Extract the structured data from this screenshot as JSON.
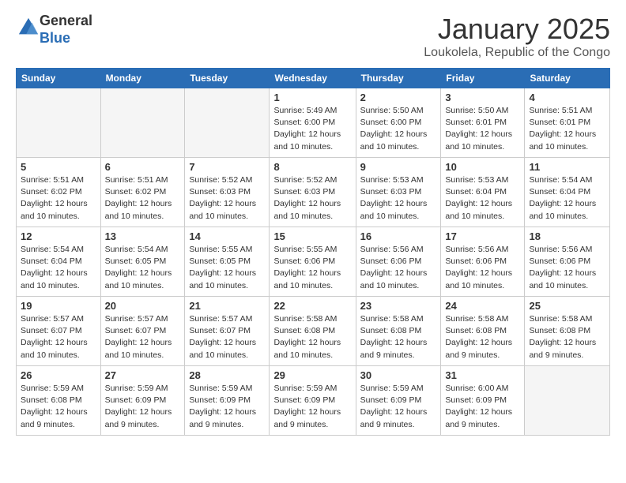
{
  "logo": {
    "general": "General",
    "blue": "Blue"
  },
  "header": {
    "month_title": "January 2025",
    "location": "Loukolela, Republic of the Congo"
  },
  "days_of_week": [
    "Sunday",
    "Monday",
    "Tuesday",
    "Wednesday",
    "Thursday",
    "Friday",
    "Saturday"
  ],
  "weeks": [
    [
      {
        "day": "",
        "info": ""
      },
      {
        "day": "",
        "info": ""
      },
      {
        "day": "",
        "info": ""
      },
      {
        "day": "1",
        "info": "Sunrise: 5:49 AM\nSunset: 6:00 PM\nDaylight: 12 hours\nand 10 minutes."
      },
      {
        "day": "2",
        "info": "Sunrise: 5:50 AM\nSunset: 6:00 PM\nDaylight: 12 hours\nand 10 minutes."
      },
      {
        "day": "3",
        "info": "Sunrise: 5:50 AM\nSunset: 6:01 PM\nDaylight: 12 hours\nand 10 minutes."
      },
      {
        "day": "4",
        "info": "Sunrise: 5:51 AM\nSunset: 6:01 PM\nDaylight: 12 hours\nand 10 minutes."
      }
    ],
    [
      {
        "day": "5",
        "info": "Sunrise: 5:51 AM\nSunset: 6:02 PM\nDaylight: 12 hours\nand 10 minutes."
      },
      {
        "day": "6",
        "info": "Sunrise: 5:51 AM\nSunset: 6:02 PM\nDaylight: 12 hours\nand 10 minutes."
      },
      {
        "day": "7",
        "info": "Sunrise: 5:52 AM\nSunset: 6:03 PM\nDaylight: 12 hours\nand 10 minutes."
      },
      {
        "day": "8",
        "info": "Sunrise: 5:52 AM\nSunset: 6:03 PM\nDaylight: 12 hours\nand 10 minutes."
      },
      {
        "day": "9",
        "info": "Sunrise: 5:53 AM\nSunset: 6:03 PM\nDaylight: 12 hours\nand 10 minutes."
      },
      {
        "day": "10",
        "info": "Sunrise: 5:53 AM\nSunset: 6:04 PM\nDaylight: 12 hours\nand 10 minutes."
      },
      {
        "day": "11",
        "info": "Sunrise: 5:54 AM\nSunset: 6:04 PM\nDaylight: 12 hours\nand 10 minutes."
      }
    ],
    [
      {
        "day": "12",
        "info": "Sunrise: 5:54 AM\nSunset: 6:04 PM\nDaylight: 12 hours\nand 10 minutes."
      },
      {
        "day": "13",
        "info": "Sunrise: 5:54 AM\nSunset: 6:05 PM\nDaylight: 12 hours\nand 10 minutes."
      },
      {
        "day": "14",
        "info": "Sunrise: 5:55 AM\nSunset: 6:05 PM\nDaylight: 12 hours\nand 10 minutes."
      },
      {
        "day": "15",
        "info": "Sunrise: 5:55 AM\nSunset: 6:06 PM\nDaylight: 12 hours\nand 10 minutes."
      },
      {
        "day": "16",
        "info": "Sunrise: 5:56 AM\nSunset: 6:06 PM\nDaylight: 12 hours\nand 10 minutes."
      },
      {
        "day": "17",
        "info": "Sunrise: 5:56 AM\nSunset: 6:06 PM\nDaylight: 12 hours\nand 10 minutes."
      },
      {
        "day": "18",
        "info": "Sunrise: 5:56 AM\nSunset: 6:06 PM\nDaylight: 12 hours\nand 10 minutes."
      }
    ],
    [
      {
        "day": "19",
        "info": "Sunrise: 5:57 AM\nSunset: 6:07 PM\nDaylight: 12 hours\nand 10 minutes."
      },
      {
        "day": "20",
        "info": "Sunrise: 5:57 AM\nSunset: 6:07 PM\nDaylight: 12 hours\nand 10 minutes."
      },
      {
        "day": "21",
        "info": "Sunrise: 5:57 AM\nSunset: 6:07 PM\nDaylight: 12 hours\nand 10 minutes."
      },
      {
        "day": "22",
        "info": "Sunrise: 5:58 AM\nSunset: 6:08 PM\nDaylight: 12 hours\nand 10 minutes."
      },
      {
        "day": "23",
        "info": "Sunrise: 5:58 AM\nSunset: 6:08 PM\nDaylight: 12 hours\nand 9 minutes."
      },
      {
        "day": "24",
        "info": "Sunrise: 5:58 AM\nSunset: 6:08 PM\nDaylight: 12 hours\nand 9 minutes."
      },
      {
        "day": "25",
        "info": "Sunrise: 5:58 AM\nSunset: 6:08 PM\nDaylight: 12 hours\nand 9 minutes."
      }
    ],
    [
      {
        "day": "26",
        "info": "Sunrise: 5:59 AM\nSunset: 6:08 PM\nDaylight: 12 hours\nand 9 minutes."
      },
      {
        "day": "27",
        "info": "Sunrise: 5:59 AM\nSunset: 6:09 PM\nDaylight: 12 hours\nand 9 minutes."
      },
      {
        "day": "28",
        "info": "Sunrise: 5:59 AM\nSunset: 6:09 PM\nDaylight: 12 hours\nand 9 minutes."
      },
      {
        "day": "29",
        "info": "Sunrise: 5:59 AM\nSunset: 6:09 PM\nDaylight: 12 hours\nand 9 minutes."
      },
      {
        "day": "30",
        "info": "Sunrise: 5:59 AM\nSunset: 6:09 PM\nDaylight: 12 hours\nand 9 minutes."
      },
      {
        "day": "31",
        "info": "Sunrise: 6:00 AM\nSunset: 6:09 PM\nDaylight: 12 hours\nand 9 minutes."
      },
      {
        "day": "",
        "info": ""
      }
    ]
  ]
}
